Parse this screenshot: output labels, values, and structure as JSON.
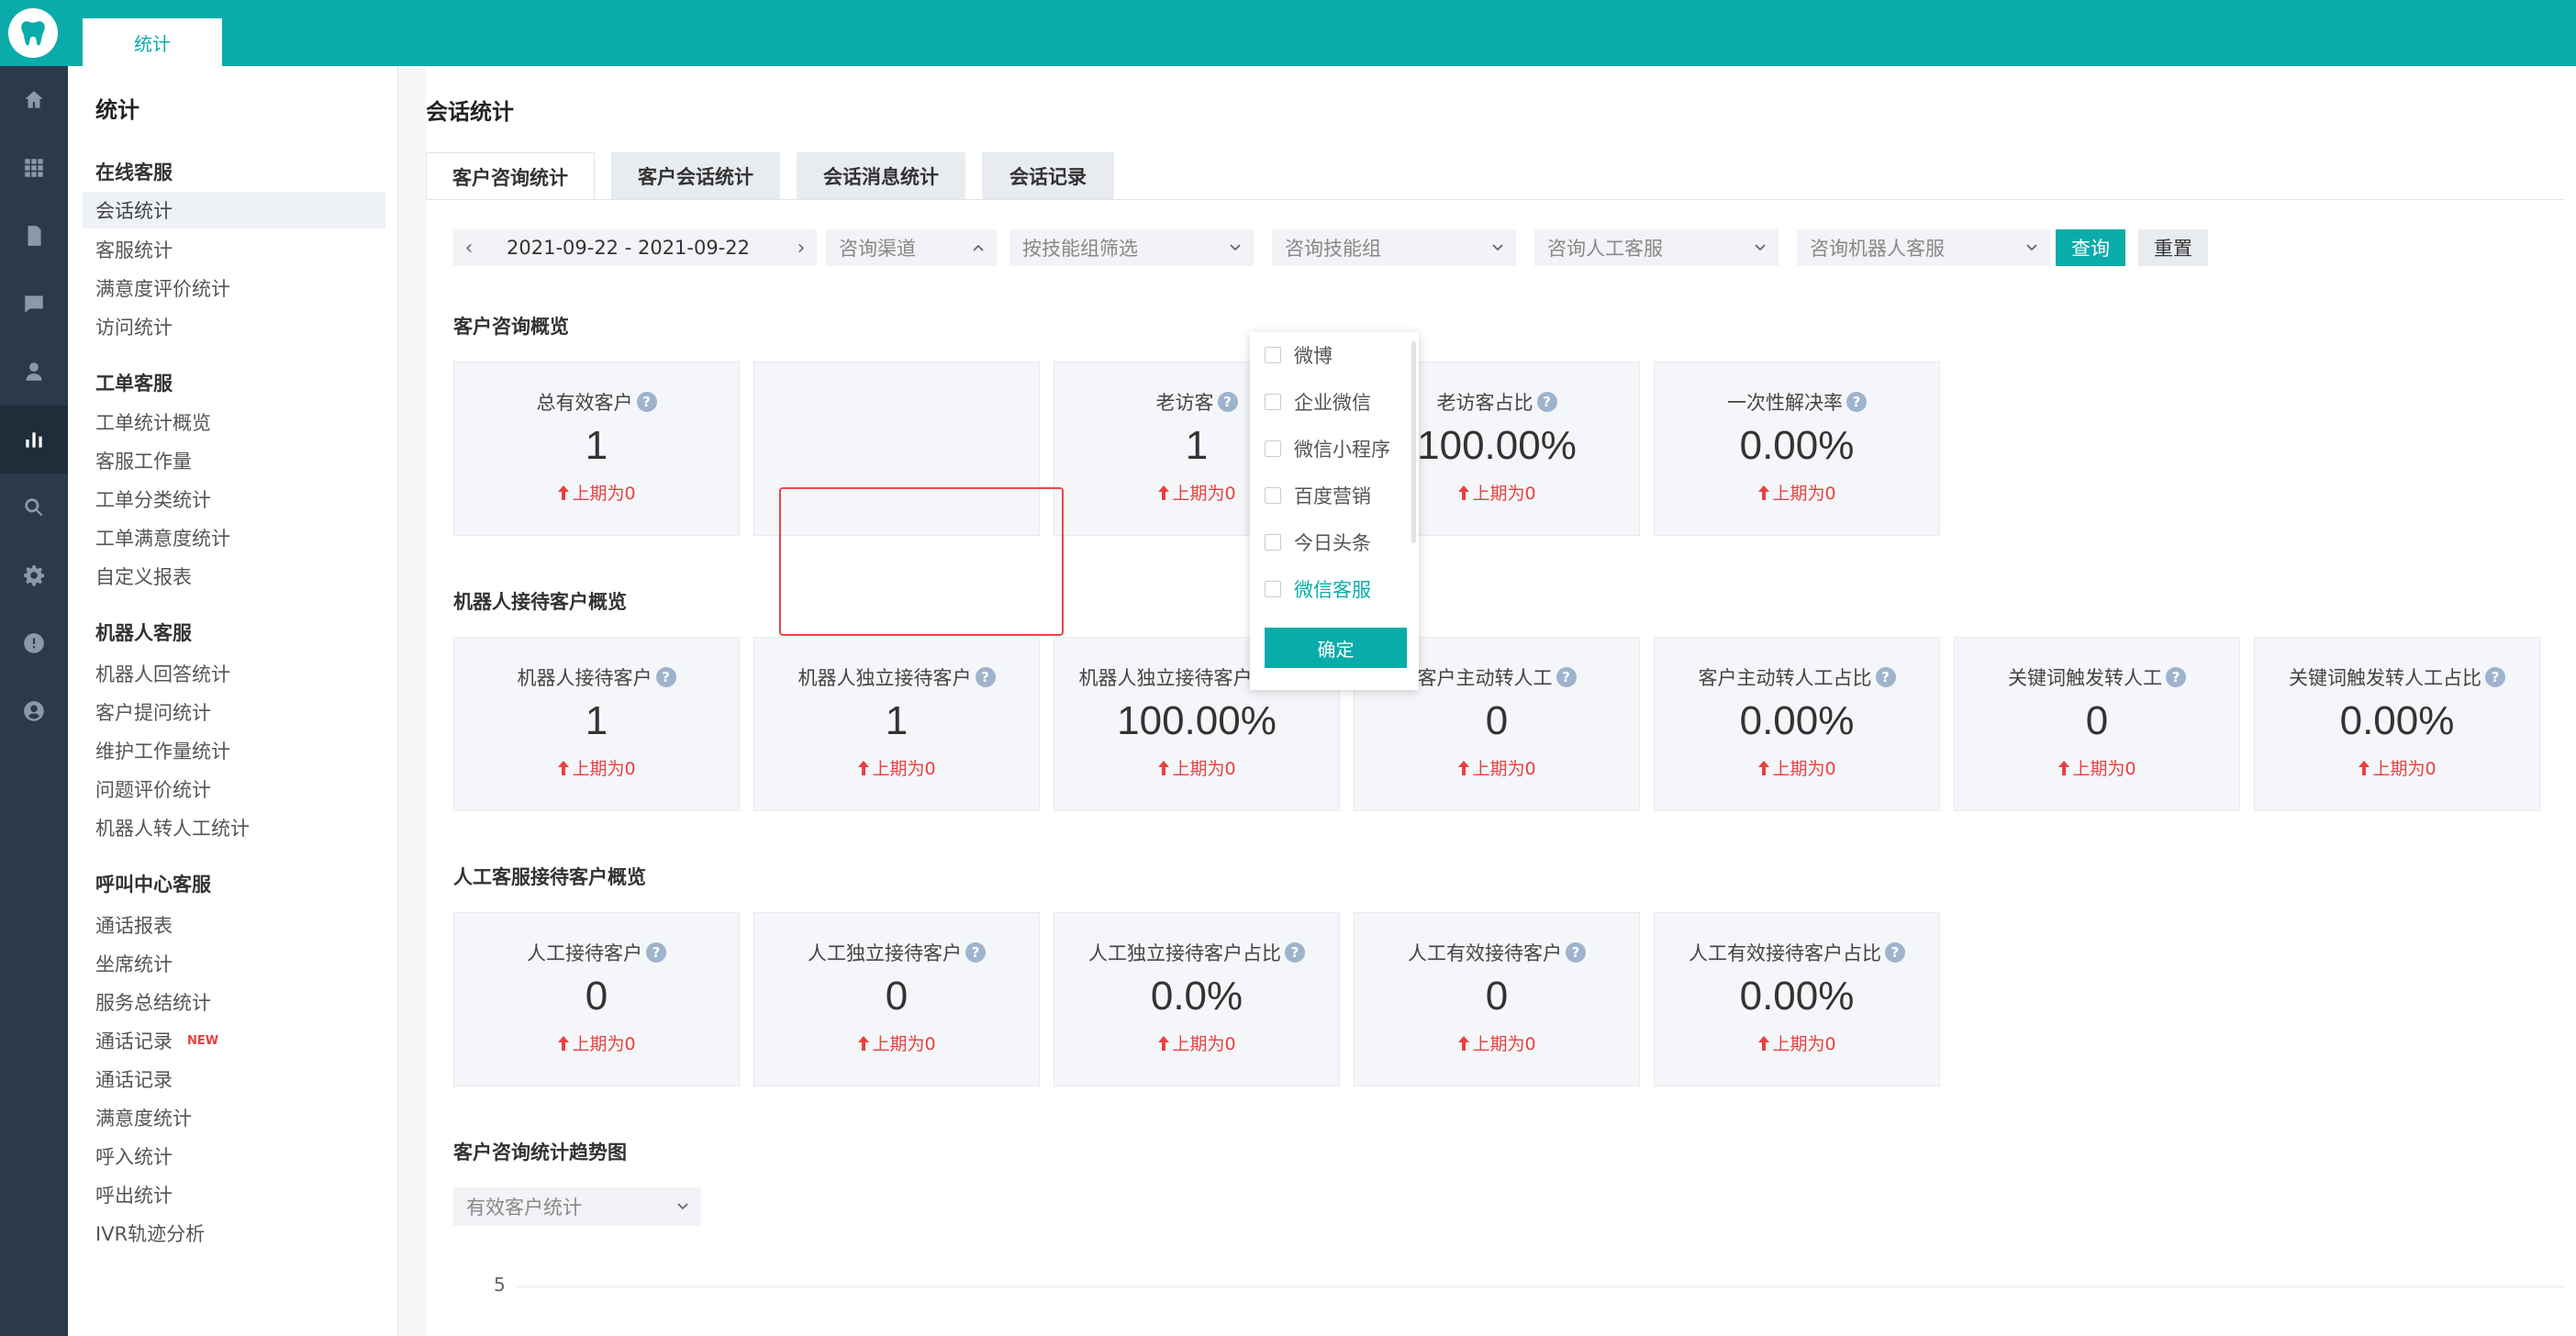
{
  "topbar": {
    "tab_label": "统计"
  },
  "rail": {
    "icons": [
      "home-icon",
      "grid-icon",
      "document-icon",
      "chat-icon",
      "user-icon",
      "bar-chart-icon",
      "search-icon",
      "gear-icon",
      "support-icon",
      "account-icon"
    ]
  },
  "sidebar": {
    "title": "统计",
    "groups": [
      {
        "label": "在线客服",
        "items": [
          "会话统计",
          "客服统计",
          "满意度评价统计",
          "访问统计"
        ]
      },
      {
        "label": "工单客服",
        "items": [
          "工单统计概览",
          "客服工作量",
          "工单分类统计",
          "工单满意度统计",
          "自定义报表"
        ]
      },
      {
        "label": "机器人客服",
        "items": [
          "机器人回答统计",
          "客户提问统计",
          "维护工作量统计",
          "问题评价统计",
          "机器人转人工统计"
        ]
      },
      {
        "label": "呼叫中心客服",
        "items": [
          "通话报表",
          "坐席统计",
          "服务总结统计",
          "通话记录",
          "通话记录",
          "满意度统计",
          "呼入统计",
          "呼出统计",
          "IVR轨迹分析"
        ]
      }
    ],
    "new_badge": "NEW"
  },
  "main": {
    "page_title": "会话统计",
    "tabs": [
      "客户咨询统计",
      "客户会话统计",
      "会话消息统计",
      "会话记录"
    ],
    "filters": {
      "date_range": "2021-09-22 - 2021-09-22",
      "channel": "咨询渠道",
      "skill_filter": "按技能组筛选",
      "skill_group": "咨询技能组",
      "agent": "咨询人工客服",
      "robot": "咨询机器人客服",
      "query_button": "查询",
      "reset_button": "重置"
    },
    "channel_dropdown": {
      "options": [
        "微博",
        "企业微信",
        "微信小程序",
        "百度营销",
        "今日头条",
        "微信客服"
      ],
      "confirm": "确定"
    },
    "sections": [
      {
        "title": "客户咨询概览",
        "cards": [
          {
            "label": "总有效客户",
            "value": "1",
            "compare": "上期为0"
          },
          {
            "label": "",
            "value": "",
            "compare": ""
          },
          {
            "label": "老访客",
            "value": "1",
            "compare": "上期为0"
          },
          {
            "label": "老访客占比",
            "value": "100.00%",
            "compare": "上期为0"
          },
          {
            "label": "一次性解决率",
            "value": "0.00%",
            "compare": "上期为0"
          }
        ]
      },
      {
        "title": "机器人接待客户概览",
        "cards": [
          {
            "label": "机器人接待客户",
            "value": "1",
            "compare": "上期为0"
          },
          {
            "label": "机器人独立接待客户",
            "value": "1",
            "compare": "上期为0"
          },
          {
            "label": "机器人独立接待客户占比",
            "value": "100.00%",
            "compare": "上期为0"
          },
          {
            "label": "客户主动转人工",
            "value": "0",
            "compare": "上期为0"
          },
          {
            "label": "客户主动转人工占比",
            "value": "0.00%",
            "compare": "上期为0"
          },
          {
            "label": "关键词触发转人工",
            "value": "0",
            "compare": "上期为0"
          },
          {
            "label": "关键词触发转人工占比",
            "value": "0.00%",
            "compare": "上期为0"
          }
        ]
      },
      {
        "title": "人工客服接待客户概览",
        "cards": [
          {
            "label": "人工接待客户",
            "value": "0",
            "compare": "上期为0"
          },
          {
            "label": "人工独立接待客户",
            "value": "0",
            "compare": "上期为0"
          },
          {
            "label": "人工独立接待客户占比",
            "value": "0.0%",
            "compare": "上期为0"
          },
          {
            "label": "人工有效接待客户",
            "value": "0",
            "compare": "上期为0"
          },
          {
            "label": "人工有效接待客户占比",
            "value": "0.00%",
            "compare": "上期为0"
          }
        ]
      }
    ],
    "trend": {
      "title": "客户咨询统计趋势图",
      "select": "有效客户统计",
      "y_tick": "5"
    }
  },
  "colors": {
    "accent": "#0aacaa",
    "rail": "#2a3a4a",
    "increase": "#e94040",
    "highlight_box": "#e54848"
  }
}
